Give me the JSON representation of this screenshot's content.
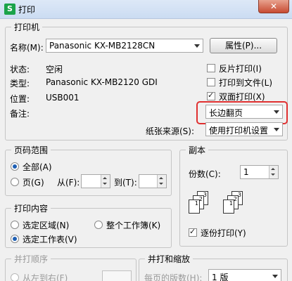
{
  "window": {
    "title": "打印",
    "app_icon_text": "S",
    "close_glyph": "✕"
  },
  "printer": {
    "group_title": "打印机",
    "name_label": "名称(M):",
    "name_value": "Panasonic KX-MB2128CN",
    "properties_button": "属性(P)...",
    "status_label": "状态:",
    "status_value": "空闲",
    "type_label": "类型:",
    "type_value": "Panasonic KX-MB2120 GDI",
    "location_label": "位置:",
    "location_value": "USB001",
    "comment_label": "备注:",
    "reverse_print": "反片打印(I)",
    "print_to_file": "打印到文件(L)",
    "duplex_print": "双面打印(X)",
    "duplex_mode": "长边翻页",
    "paper_source_label": "纸张来源(S):",
    "paper_source_value": "使用打印机设置"
  },
  "page_range": {
    "group_title": "页码范围",
    "all": "全部(A)",
    "pages": "页(G)",
    "from_label": "从(F):",
    "to_label": "到(T):"
  },
  "copies": {
    "group_title": "副本",
    "count_label": "份数(C):",
    "count_value": "1",
    "collate": "逐份打印(Y)",
    "page_labels": [
      "1",
      "2",
      "3"
    ]
  },
  "print_content": {
    "group_title": "打印内容",
    "selection": "选定区域(N)",
    "entire_workbook": "整个工作簿(K)",
    "selected_sheets": "选定工作表(V)"
  },
  "print_order": {
    "group_title": "并打顺序",
    "left_to_right": "从左到右(F)"
  },
  "scale": {
    "group_title": "并打和缩放",
    "pages_per_sheet_label": "每页的版数(H):",
    "pages_per_sheet_value": "1 版"
  }
}
